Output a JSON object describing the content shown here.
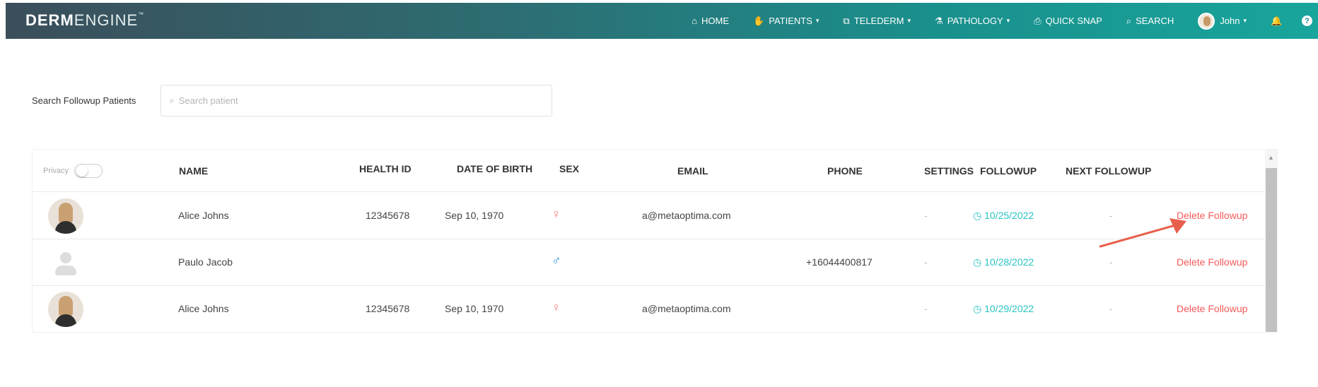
{
  "brand": {
    "bold": "DERM",
    "light": "ENGINE",
    "tm": "™"
  },
  "nav": [
    {
      "label": "HOME",
      "icon": "home-icon",
      "glyph": "⌂",
      "caret": ""
    },
    {
      "label": "PATIENTS",
      "icon": "patients-icon",
      "glyph": "✋",
      "caret": "▾"
    },
    {
      "label": "TELEDERM",
      "icon": "telederm-icon",
      "glyph": "⧉",
      "caret": "▾"
    },
    {
      "label": "PATHOLOGY",
      "icon": "microscope-icon",
      "glyph": "⚗",
      "caret": "▾"
    },
    {
      "label": "QUICK SNAP",
      "icon": "camera-icon",
      "glyph": "⎙",
      "caret": ""
    },
    {
      "label": "SEARCH",
      "icon": "search-icon",
      "glyph": "⌕",
      "caret": ""
    }
  ],
  "user": {
    "name": "John",
    "caret": "▾"
  },
  "help_glyph": "?",
  "search": {
    "label": "Search Followup Patients",
    "placeholder": "Search patient",
    "icon_glyph": "⌕"
  },
  "table": {
    "privacy_label": "Privacy",
    "columns": {
      "name": "NAME",
      "health_id": "HEALTH ID",
      "dob": "DATE OF BIRTH",
      "sex": "SEX",
      "email": "EMAIL",
      "phone": "PHONE",
      "settings": "SETTINGS",
      "followup": "FOLLOWUP",
      "next_followup": "NEXT FOLLOWUP"
    },
    "rows": [
      {
        "avatar": "photo",
        "name": "Alice Johns",
        "health_id": "12345678",
        "dob": "Sep 10, 1970",
        "sex": "female",
        "sex_glyph": "♀",
        "email": "a@metaoptima.com",
        "phone": "",
        "settings": "-",
        "followup": "◷ 10/25/2022",
        "next_followup": "-",
        "action": "Delete Followup"
      },
      {
        "avatar": "generic",
        "name": "Paulo Jacob",
        "health_id": "",
        "dob": "",
        "sex": "male",
        "sex_glyph": "♂",
        "email": "",
        "phone": "+16044400817",
        "settings": "-",
        "followup": "◷ 10/28/2022",
        "next_followup": "-",
        "action": "Delete Followup"
      },
      {
        "avatar": "photo",
        "name": "Alice Johns",
        "health_id": "12345678",
        "dob": "Sep 10, 1970",
        "sex": "female",
        "sex_glyph": "♀",
        "email": "a@metaoptima.com",
        "phone": "",
        "settings": "-",
        "followup": "◷ 10/29/2022",
        "next_followup": "-",
        "action": "Delete Followup"
      }
    ]
  },
  "colors": {
    "nav_start": "#3b4e5b",
    "nav_end": "#18a59c",
    "followup": "#2ac3c3",
    "delete": "#f55a5a",
    "annotation_arrow": "#e8604c"
  }
}
